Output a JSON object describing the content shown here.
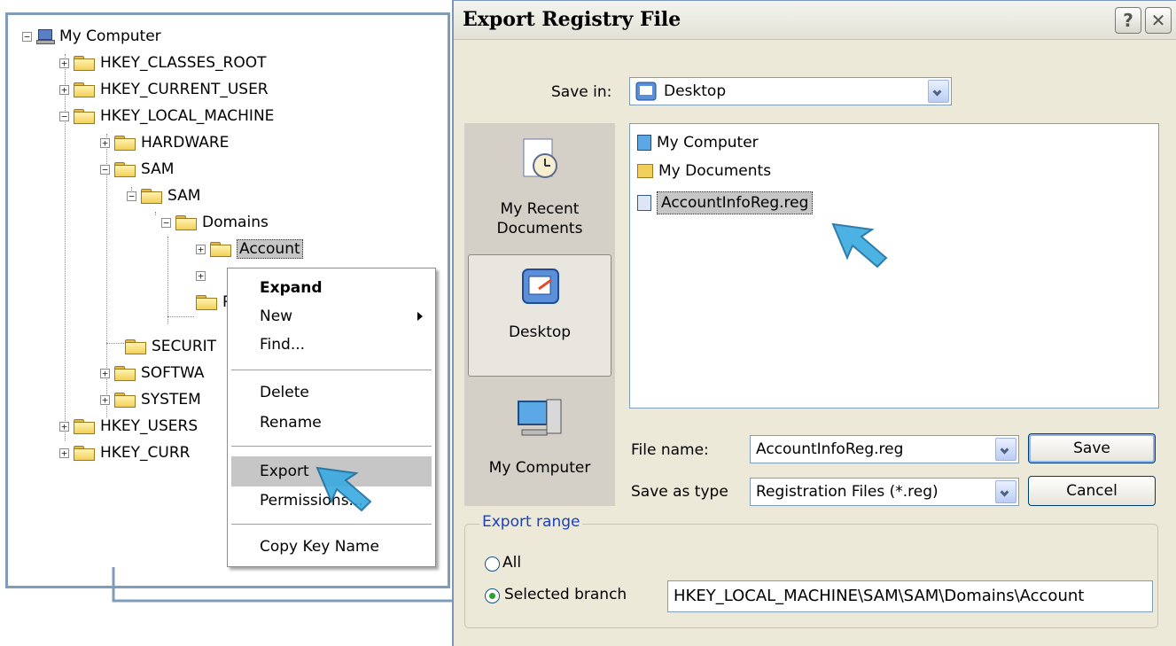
{
  "tree": {
    "root": "My Computer",
    "nodes": [
      {
        "label": "HKEY_CLASSES_ROOT",
        "toggle": "+"
      },
      {
        "label": "HKEY_CURRENT_USER",
        "toggle": "+"
      },
      {
        "label": "HKEY_LOCAL_MACHINE",
        "toggle": "−"
      },
      {
        "label": "HARDWARE",
        "toggle": "+"
      },
      {
        "label": "SAM",
        "toggle": "−"
      },
      {
        "label": "SAM",
        "toggle": "−"
      },
      {
        "label": "Domains",
        "toggle": "−"
      },
      {
        "label": "Account",
        "toggle": "+"
      },
      {
        "label": "SECURIT"
      },
      {
        "label": "SOFTWA",
        "toggle": "+"
      },
      {
        "label": "SYSTEM",
        "toggle": "+"
      },
      {
        "label": "HKEY_USERS",
        "toggle": "+"
      },
      {
        "label": "HKEY_CURR",
        "toggle": "+"
      }
    ],
    "root_toggle": "−",
    "partial_r": "R"
  },
  "context_menu": {
    "items": [
      "Expand",
      "New",
      "Find...",
      "Delete",
      "Rename",
      "Export",
      "Permissions...",
      "Copy Key Name"
    ],
    "selected": "Export"
  },
  "dialog": {
    "title": "Export Registry File",
    "help_glyph": "?",
    "close_glyph": "✕",
    "save_in_label": "Save in:",
    "save_in_value": "Desktop",
    "places": [
      "My Recent Documents",
      "Desktop",
      "My Computer"
    ],
    "selected_place": "Desktop",
    "files": [
      "My Computer",
      "My Documents",
      "AccountInfoReg.reg"
    ],
    "selected_file": "AccountInfoReg.reg",
    "file_name_label": "File name:",
    "file_name_value": "AccountInfoReg.reg",
    "save_as_type_label": "Save as type",
    "save_as_type_value": "Registration Files (*.reg)",
    "save_button": "Save",
    "cancel_button": "Cancel",
    "export_range": {
      "label": "Export range",
      "all_label": "All",
      "selected_branch_label": "Selected branch",
      "branch_value": "HKEY_LOCAL_MACHINE\\SAM\\SAM\\Domains\\Account",
      "selected_option": "Selected branch"
    }
  },
  "colors": {
    "accent_blue": "#7f9db9",
    "dialog_bg": "#ece9d8",
    "selection_gray": "#c6c6c6",
    "export_range_label": "#1a3fbf",
    "cursor_blue": "#39a9e0"
  }
}
